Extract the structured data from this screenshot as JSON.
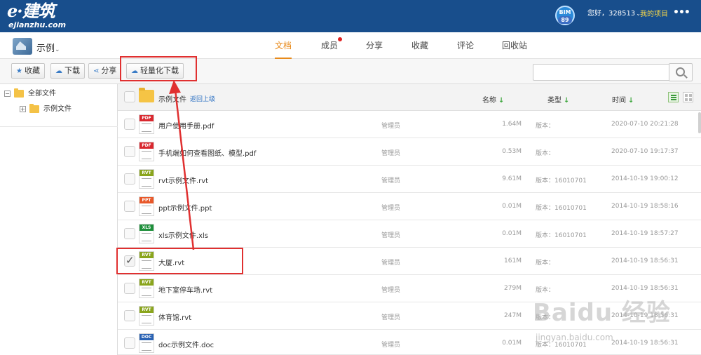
{
  "app": {
    "logo_text": "e·建筑",
    "logo_domain": "ejianzhu.com",
    "bim_badge": "BIM",
    "bim_number": "89",
    "greeting": "您好，328513",
    "my_project": "我的项目",
    "more": "•••"
  },
  "nav": {
    "project_name": "示例",
    "tabs": [
      {
        "label": "文档",
        "active": true
      },
      {
        "label": "成员",
        "active": false,
        "notification": true
      },
      {
        "label": "分享",
        "active": false
      },
      {
        "label": "收藏",
        "active": false
      },
      {
        "label": "评论",
        "active": false
      },
      {
        "label": "回收站",
        "active": false
      }
    ]
  },
  "toolbar": {
    "favorite": "收藏",
    "download": "下载",
    "share": "分享",
    "light_download": "轻量化下载",
    "search_placeholder": ""
  },
  "tree": {
    "root": "全部文件",
    "child": "示例文件"
  },
  "list": {
    "current_folder": "示例文件",
    "go_up": "返回上级",
    "col_name": "名称",
    "col_type": "类型",
    "col_time": "时间",
    "files": [
      {
        "type": "PDF",
        "name": "用户使用手册.pdf",
        "owner": "管理员",
        "size": "1.64M",
        "version": "版本：",
        "time": "2020-07-10 20:21:28",
        "checked": false
      },
      {
        "type": "PDF",
        "name": "手机端如何查看图纸、模型.pdf",
        "owner": "管理员",
        "size": "0.53M",
        "version": "版本：",
        "time": "2020-07-10 19:17:37",
        "checked": false
      },
      {
        "type": "RVT",
        "name": "rvt示例文件.rvt",
        "owner": "管理员",
        "size": "9.61M",
        "version": "版本：16010701",
        "time": "2014-10-19 19:00:12",
        "checked": false
      },
      {
        "type": "PPT",
        "name": "ppt示例文件.ppt",
        "owner": "管理员",
        "size": "0.01M",
        "version": "版本：16010701",
        "time": "2014-10-19 18:58:16",
        "checked": false
      },
      {
        "type": "XLS",
        "name": "xls示例文件.xls",
        "owner": "管理员",
        "size": "0.01M",
        "version": "版本：16010701",
        "time": "2014-10-19 18:57:27",
        "checked": false
      },
      {
        "type": "RVT",
        "name": "大厦.rvt",
        "owner": "管理员",
        "size": "161M",
        "version": "版本：",
        "time": "2014-10-19 18:56:31",
        "checked": true
      },
      {
        "type": "RVT",
        "name": "地下室停车场.rvt",
        "owner": "管理员",
        "size": "279M",
        "version": "版本：",
        "time": "2014-10-19 18:56:31",
        "checked": false
      },
      {
        "type": "RVT",
        "name": "体育馆.rvt",
        "owner": "管理员",
        "size": "247M",
        "version": "版本：",
        "time": "2014-10-19 18:56:31",
        "checked": false
      },
      {
        "type": "DOC",
        "name": "doc示例文件.doc",
        "owner": "管理员",
        "size": "0.01M",
        "version": "版本：16010701",
        "time": "2014-10-19 18:56:31",
        "checked": false
      }
    ]
  },
  "watermark": {
    "main": "Baidu 经验",
    "sub": "jingyan.baidu.com"
  },
  "colors": {
    "header_bg": "#184e8c",
    "accent_tab": "#e88a1a",
    "annotation": "#e03030",
    "my_project": "#f4d64a",
    "pdf": "#d9272e",
    "rvt": "#8aa51c",
    "ppt": "#e8582a",
    "xls": "#1d8f3a",
    "doc": "#2a62b3"
  }
}
